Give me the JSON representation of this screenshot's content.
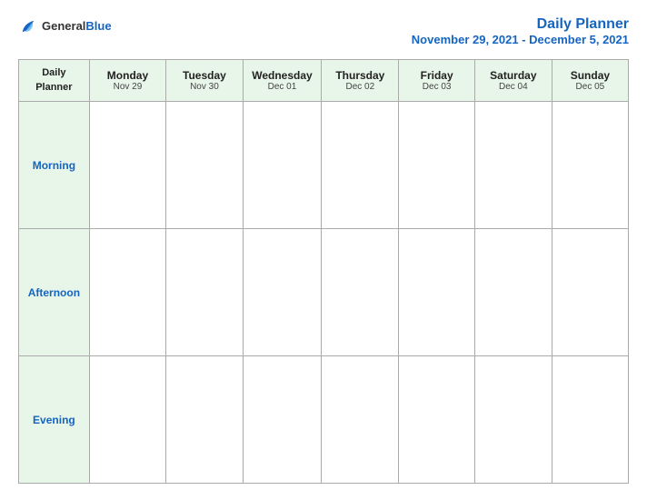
{
  "header": {
    "logo_general": "General",
    "logo_blue": "Blue",
    "title": "Daily Planner",
    "subtitle": "November 29, 2021 - December 5, 2021"
  },
  "table": {
    "col0_header_line1": "Daily",
    "col0_header_line2": "Planner",
    "columns": [
      {
        "day": "Monday",
        "date": "Nov 29"
      },
      {
        "day": "Tuesday",
        "date": "Nov 30"
      },
      {
        "day": "Wednesday",
        "date": "Dec 01"
      },
      {
        "day": "Thursday",
        "date": "Dec 02"
      },
      {
        "day": "Friday",
        "date": "Dec 03"
      },
      {
        "day": "Saturday",
        "date": "Dec 04"
      },
      {
        "day": "Sunday",
        "date": "Dec 05"
      }
    ],
    "rows": [
      {
        "label": "Morning"
      },
      {
        "label": "Afternoon"
      },
      {
        "label": "Evening"
      }
    ]
  }
}
